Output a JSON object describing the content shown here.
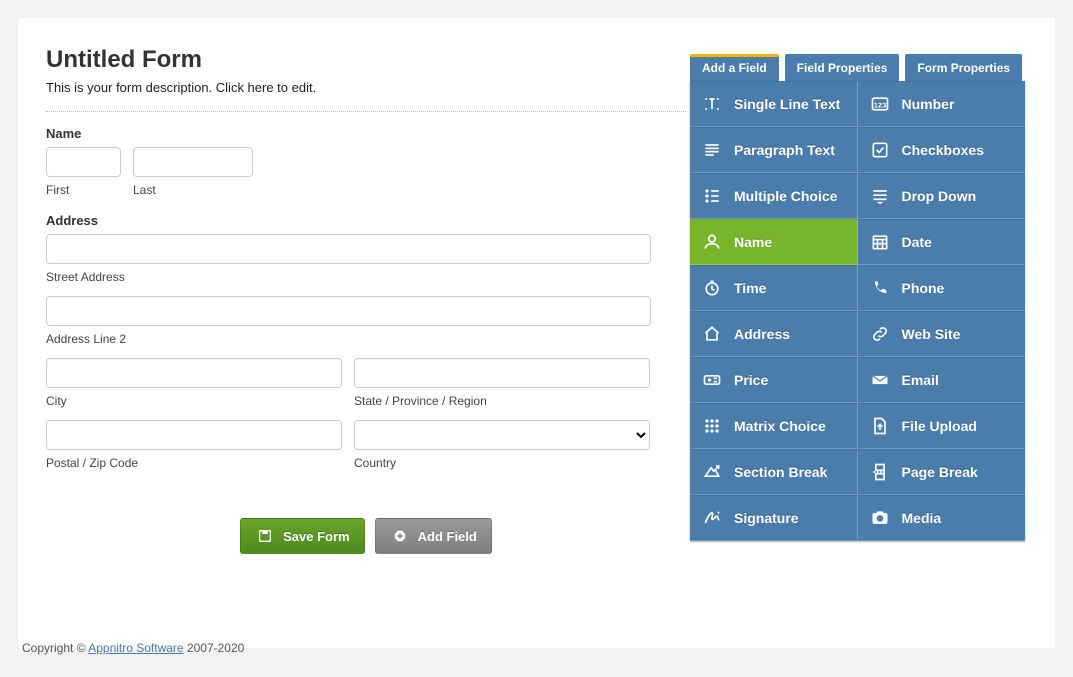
{
  "form": {
    "title": "Untitled Form",
    "description": "This is your form description. Click here to edit."
  },
  "fields": {
    "name": {
      "label": "Name",
      "first": "First",
      "last": "Last"
    },
    "address": {
      "label": "Address",
      "street": "Street Address",
      "line2": "Address Line 2",
      "city": "City",
      "state": "State / Province / Region",
      "postal": "Postal / Zip Code",
      "country": "Country"
    }
  },
  "buttons": {
    "save": "Save Form",
    "add": "Add Field"
  },
  "tabs": {
    "add": "Add a Field",
    "field": "Field Properties",
    "form": "Form Properties"
  },
  "palette": [
    {
      "id": "single-line-text",
      "label": "Single Line Text"
    },
    {
      "id": "number",
      "label": "Number"
    },
    {
      "id": "paragraph-text",
      "label": "Paragraph Text"
    },
    {
      "id": "checkboxes",
      "label": "Checkboxes"
    },
    {
      "id": "multiple-choice",
      "label": "Multiple Choice"
    },
    {
      "id": "drop-down",
      "label": "Drop Down"
    },
    {
      "id": "name",
      "label": "Name"
    },
    {
      "id": "date",
      "label": "Date"
    },
    {
      "id": "time",
      "label": "Time"
    },
    {
      "id": "phone",
      "label": "Phone"
    },
    {
      "id": "address",
      "label": "Address"
    },
    {
      "id": "web-site",
      "label": "Web Site"
    },
    {
      "id": "price",
      "label": "Price"
    },
    {
      "id": "email",
      "label": "Email"
    },
    {
      "id": "matrix-choice",
      "label": "Matrix Choice"
    },
    {
      "id": "file-upload",
      "label": "File Upload"
    },
    {
      "id": "section-break",
      "label": "Section Break"
    },
    {
      "id": "page-break",
      "label": "Page Break"
    },
    {
      "id": "signature",
      "label": "Signature"
    },
    {
      "id": "media",
      "label": "Media"
    }
  ],
  "palette_active": "name",
  "footer": {
    "prefix": "Copyright © ",
    "link": "Appnitro Software",
    "suffix": " 2007-2020"
  }
}
